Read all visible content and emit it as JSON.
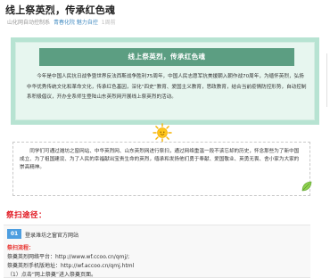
{
  "article": {
    "title": "线上祭英烈，传承红色魂",
    "source": "山化网自动控制系",
    "author": "青春化院 魅力自控",
    "reads": "1周前"
  },
  "card": {
    "heading": "线上祭英烈，传承红色魂",
    "body": "今年是中国人民抗日战争暨世界反法西斯战争胜利75周年，中国人民志愿军抗美援朝入朝作战70周年，为缅怀英烈，弘扬中华优秀传统文化和革命文化，传承红色基因，深化“四史”教育、爱国主义教育，思政教育，结合当前疫情防控形势，自动控制系积极倡议，开办全系师生登陆山东英烈网开展线上祭英烈的活动。"
  },
  "notice": {
    "text": "同学们可通过潍坊之窗网站、中华英烈网、山东英烈网进行祭扫，通过网络重温一段不该忘却的历史，怀念那些为了新中国成立、为了祖国建设、为了人民的幸福献出宝贵生命的英烈，缅承和发扬他们勇于奉献、爱国敬业、英勇无畏、舍小家为大家的崇高精神。"
  },
  "section": {
    "title": "祭扫途径："
  },
  "step": {
    "number": "01",
    "title": "登录潍坊之窗官方网站",
    "label": "祭扫流程：",
    "lines": [
      "祭奠英烈网络平台：http://www.wf.ccoo.cn/qmj/;",
      "祭奠英烈手机版地址：http://wf.accoo.cn/qmj.html",
      "（1）点击“网上祭奠”进入祭奠页面。"
    ]
  },
  "colors": {
    "card_outer": "#b7e3d2",
    "card_heading_bg": "#5c9e82",
    "section_title": "#e0101a",
    "step_number_bg": "#4d9ee0",
    "step_label": "#e8302c"
  },
  "icons": [
    "sun-icon",
    "leaf-icon"
  ]
}
